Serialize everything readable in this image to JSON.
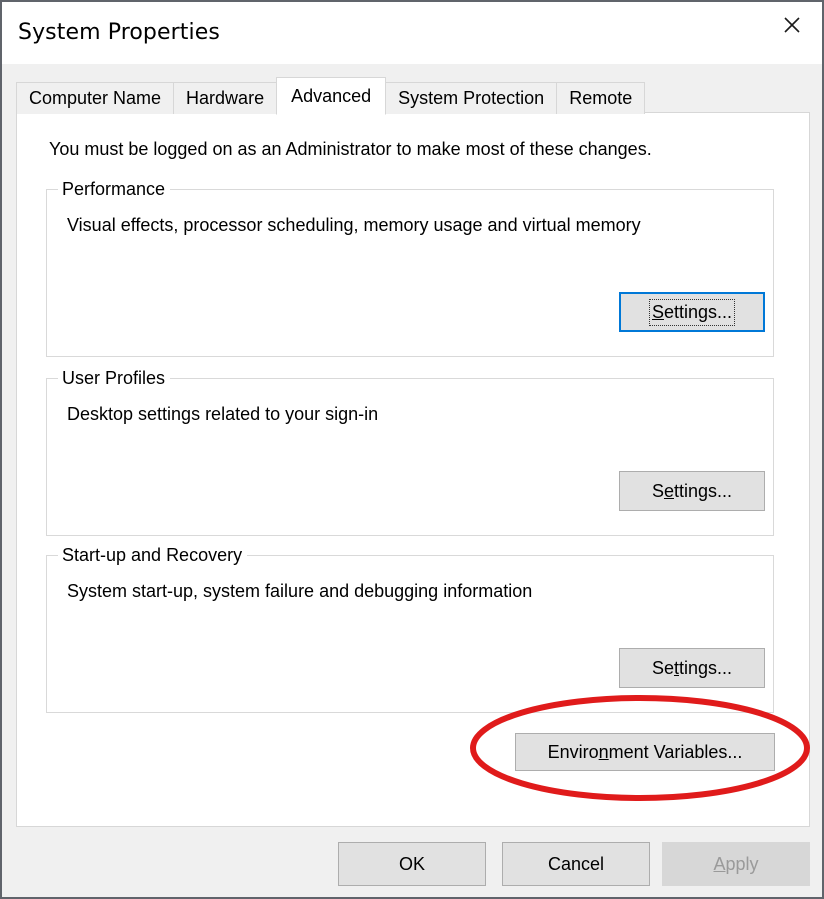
{
  "window": {
    "title": "System Properties",
    "close_label": "Close",
    "border_color": "#60646b",
    "titlebar_bg": "#ffffff",
    "body_bg": "#f0f0f0"
  },
  "tabs": [
    {
      "label": "Computer Name",
      "selected": false
    },
    {
      "label": "Hardware",
      "selected": false
    },
    {
      "label": "Advanced",
      "selected": true
    },
    {
      "label": "System Protection",
      "selected": false
    },
    {
      "label": "Remote",
      "selected": false
    }
  ],
  "panel": {
    "admin_note": "You must be logged on as an Administrator to make most of these changes.",
    "groups": [
      {
        "legend": "Performance",
        "description": "Visual effects, processor scheduling, memory usage and virtual memory",
        "button": {
          "label": "Settings...",
          "accelerator": "S",
          "prefix": "",
          "suffix": "ettings...",
          "focused": true
        }
      },
      {
        "legend": "User Profiles",
        "description": "Desktop settings related to your sign-in",
        "button": {
          "label": "Settings...",
          "accelerator": "e",
          "prefix": "S",
          "suffix": "ttings...",
          "focused": false
        }
      },
      {
        "legend": "Start-up and Recovery",
        "description": "System start-up, system failure and debugging information",
        "button": {
          "label": "Settings...",
          "accelerator": "t",
          "prefix": "Se",
          "suffix": "tings...",
          "focused": false
        }
      }
    ],
    "environment_button": {
      "label": "Environment Variables...",
      "accelerator": "n",
      "prefix": "Enviro",
      "suffix": "ment Variables..."
    }
  },
  "annotation": {
    "shape": "ellipse",
    "color": "#e01b1b",
    "stroke_width": 6,
    "target": "Environment Variables..."
  },
  "footer": {
    "ok": {
      "label": "OK",
      "disabled": false
    },
    "cancel": {
      "label": "Cancel",
      "disabled": false
    },
    "apply": {
      "label": "Apply",
      "accelerator": "A",
      "prefix": "",
      "suffix": "pply",
      "disabled": true
    }
  },
  "colors": {
    "accent_focus": "#0078d7",
    "button_face": "#e1e1e1",
    "button_border": "#adadad",
    "disabled_face": "#d7d7d7",
    "disabled_text": "#9a9a9a",
    "group_border": "#d9d9d9",
    "annotation_red": "#e01b1b"
  }
}
